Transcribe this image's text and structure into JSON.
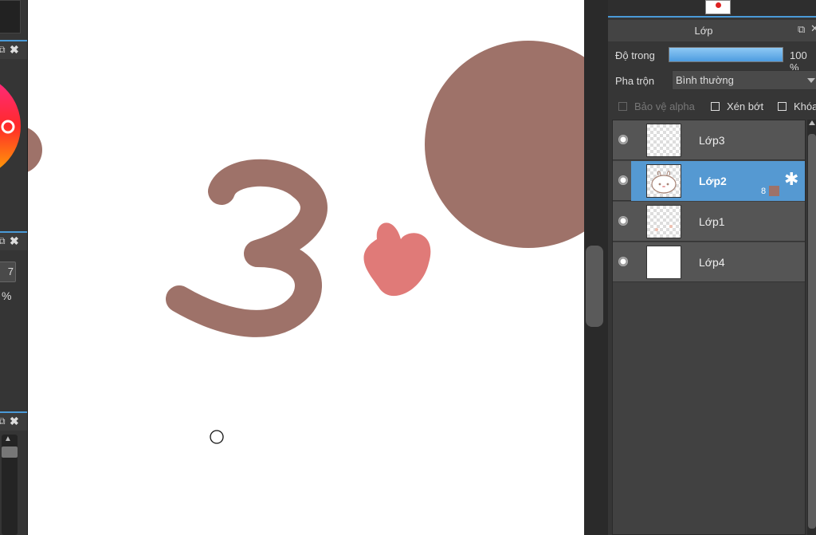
{
  "layers_panel": {
    "title": "Lớp",
    "opacity_label": "Độ trong",
    "opacity_value": "100 %",
    "opacity_fraction": 1.0,
    "blend_label": "Pha trộn",
    "blend_value": "Bình thường",
    "checkboxes": {
      "protect_alpha": "Bảo vệ alpha",
      "clipping": "Xén bớt",
      "lock": "Khóa"
    },
    "layers": [
      {
        "name": "Lớp3"
      },
      {
        "name": "Lớp2",
        "selected": true,
        "badge": "8"
      },
      {
        "name": "Lớp1"
      },
      {
        "name": "Lớp4"
      }
    ]
  },
  "left_dock": {
    "number_value": "7",
    "percent_label": "%"
  },
  "colors": {
    "accent": "#4a9ad8",
    "selected_layer": "#5599d2",
    "stroke_brown": "#9e7269",
    "heart_pink": "#e07a78"
  },
  "icons": {
    "layer_settings": "gear-icon",
    "visibility": "eye-icon",
    "panel_close": "close-icon",
    "panel_pin": "pin-icon"
  }
}
